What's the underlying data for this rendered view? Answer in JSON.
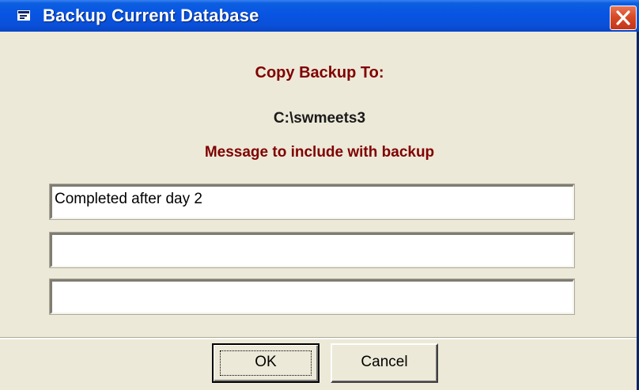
{
  "window": {
    "title": "Backup Current Database",
    "icon": "app-window-icon",
    "close_icon": "close-x-icon",
    "title_color": "#ffffff",
    "titlebar_color": "#0a50d8",
    "close_color": "#d74a26"
  },
  "content": {
    "copy_heading": "Copy Backup To:",
    "backup_path": "C:\\swmeets3",
    "message_heading": "Message to include with backup",
    "heading_color": "#800000",
    "message_lines": [
      {
        "value": "Completed after day 2"
      },
      {
        "value": ""
      },
      {
        "value": ""
      }
    ]
  },
  "buttons": {
    "ok_label": "OK",
    "cancel_label": "Cancel"
  }
}
